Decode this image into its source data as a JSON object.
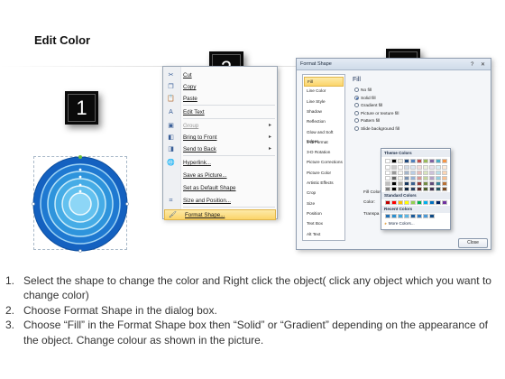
{
  "header": {
    "title": "Edit Color"
  },
  "badges": [
    "1",
    "2",
    "3"
  ],
  "context_menu": {
    "items": [
      {
        "icon": "scissors-icon",
        "glyph": "✂",
        "label": "Cut",
        "disabled": false,
        "submenu": false
      },
      {
        "icon": "copy-icon",
        "glyph": "❐",
        "label": "Copy",
        "disabled": false,
        "submenu": false
      },
      {
        "icon": "paste-icon",
        "glyph": "📋",
        "label": "Paste",
        "disabled": false,
        "submenu": false
      },
      {
        "icon": "edit-text-icon",
        "glyph": "A",
        "label": "Edit Text",
        "disabled": false,
        "submenu": false
      },
      {
        "icon": "group-icon",
        "glyph": "▣",
        "label": "Group",
        "disabled": true,
        "submenu": true
      },
      {
        "icon": "bring-front-icon",
        "glyph": "◧",
        "label": "Bring to Front",
        "disabled": false,
        "submenu": true
      },
      {
        "icon": "send-back-icon",
        "glyph": "◨",
        "label": "Send to Back",
        "disabled": false,
        "submenu": true
      },
      {
        "icon": "hyperlink-icon",
        "glyph": "🌐",
        "label": "Hyperlink...",
        "disabled": false,
        "submenu": false
      },
      {
        "icon": "save-picture-icon",
        "glyph": "",
        "label": "Save as Picture...",
        "disabled": false,
        "submenu": false
      },
      {
        "icon": "default-shape-icon",
        "glyph": "",
        "label": "Set as Default Shape",
        "disabled": false,
        "submenu": false
      },
      {
        "icon": "size-position-icon",
        "glyph": "⌗",
        "label": "Size and Position...",
        "disabled": false,
        "submenu": false
      },
      {
        "icon": "format-shape-icon",
        "glyph": "🖌",
        "label": "Format Shape...",
        "disabled": false,
        "submenu": false,
        "highlighted": true
      }
    ]
  },
  "dialog": {
    "title": "Format Shape",
    "window_controls": "? ✕",
    "categories": [
      "Fill",
      "Line Color",
      "Line Style",
      "Shadow",
      "Reflection",
      "Glow and Soft Edges",
      "3-D Format",
      "3-D Rotation",
      "Picture Corrections",
      "Picture Color",
      "Artistic Effects",
      "Crop",
      "Size",
      "Position",
      "Text Box",
      "Alt Text"
    ],
    "selected_category": "Fill",
    "section_heading": "Fill",
    "fill_options": [
      "No fill",
      "Solid fill",
      "Gradient fill",
      "Picture or texture fill",
      "Pattern fill",
      "Slide background fill"
    ],
    "selected_fill": "Solid fill",
    "fill_color_label": "Fill Color",
    "color_label": "Color:",
    "transparency_label": "Transpa",
    "close_label": "Close"
  },
  "color_popup": {
    "theme_heading": "Theme Colors",
    "standard_heading": "Standard Colors",
    "recent_heading": "Recent Colors",
    "more_label": "More Colors...",
    "theme_top": [
      "#ffffff",
      "#000000",
      "#eeece1",
      "#1f497d",
      "#4f81bd",
      "#c0504d",
      "#9bbb59",
      "#8064a2",
      "#4bacc6",
      "#f79646"
    ],
    "standard": [
      "#c00000",
      "#ff0000",
      "#ffc000",
      "#ffff00",
      "#92d050",
      "#00b050",
      "#00b0f0",
      "#0070c0",
      "#002060",
      "#7030a0"
    ],
    "recent": [
      "#1f6fb5",
      "#2a8fd0",
      "#3ba7e0",
      "#5bb8e8",
      "#1a5a9a",
      "#2d7bc4",
      "#4a9ad8",
      "#0d4a85"
    ]
  },
  "instructions": [
    {
      "num": "1.",
      "text": "Select the shape to change the color and Right click the object( click any object which you want to change color)"
    },
    {
      "num": "2.",
      "text": "Choose Format Shape in the dialog box."
    },
    {
      "num": "3.",
      "text": "Choose “Fill” in the Format Shape box then “Solid” or “Gradient” depending on the appearance of the object. Change colour as shown in the picture."
    }
  ]
}
